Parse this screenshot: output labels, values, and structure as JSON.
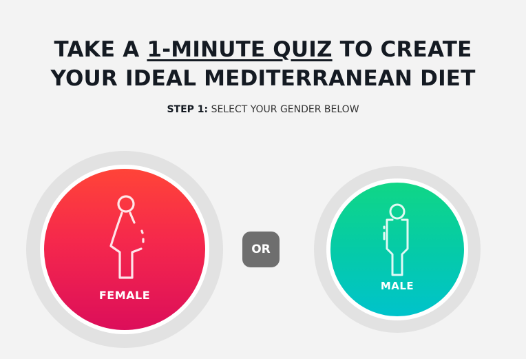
{
  "headline": {
    "part1": "TAKE A ",
    "part2": "1-MINUTE QUIZ",
    "part3": " TO CREATE",
    "line2": "YOUR IDEAL MEDITERRANEAN DIET"
  },
  "step": {
    "label": "STEP 1:",
    "text": " SELECT YOUR GENDER BELOW"
  },
  "options": {
    "female": {
      "label": "FEMALE",
      "icon": "female-figure-icon",
      "gradient": [
        "#ff4438",
        "#dc0e5a"
      ]
    },
    "male": {
      "label": "MALE",
      "icon": "male-figure-icon",
      "gradient": [
        "#10d686",
        "#00c3cb"
      ]
    }
  },
  "separator": {
    "label": "OR"
  },
  "colors": {
    "background": "#f3f3f3",
    "text": "#141a22",
    "or_badge": "#6e6e6e"
  }
}
